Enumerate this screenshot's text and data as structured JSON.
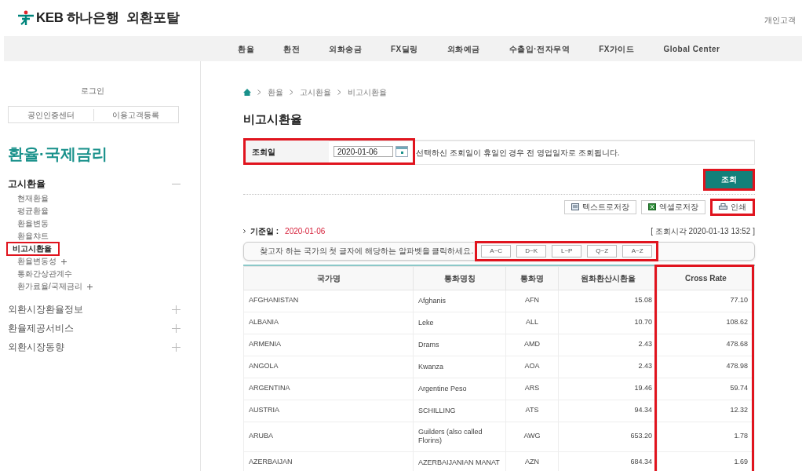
{
  "header": {
    "logo_text": "KEB 하나은행",
    "portal": "외환포탈",
    "customer_link": "개인고객"
  },
  "nav": [
    "환율",
    "환전",
    "외화송금",
    "FX딜링",
    "외화예금",
    "수출입·전자무역",
    "FX가이드",
    "Global Center"
  ],
  "sidebar": {
    "login": "로그인",
    "buttons": [
      "공인인증센터",
      "이용고객등록"
    ],
    "title": "환율·국제금리",
    "sections": [
      {
        "label": "고시환율",
        "expanded": true,
        "children": [
          {
            "label": "현재환율",
            "selected": false,
            "has_sub": false,
            "highlighted": false
          },
          {
            "label": "평균환율",
            "selected": false,
            "has_sub": false,
            "highlighted": false
          },
          {
            "label": "환율변동",
            "selected": false,
            "has_sub": false,
            "highlighted": false
          },
          {
            "label": "환율챠트",
            "selected": false,
            "has_sub": false,
            "highlighted": false
          },
          {
            "label": "비고시환율",
            "selected": true,
            "has_sub": false,
            "highlighted": true
          },
          {
            "label": "환율변동성",
            "selected": false,
            "has_sub": true,
            "highlighted": false
          },
          {
            "label": "통화간상관계수",
            "selected": false,
            "has_sub": false,
            "highlighted": false
          },
          {
            "label": "환가료율/국제금리",
            "selected": false,
            "has_sub": true,
            "highlighted": false
          }
        ]
      },
      {
        "label": "외환시장환율정보",
        "expanded": false
      },
      {
        "label": "환율제공서비스",
        "expanded": false
      },
      {
        "label": "외환시장동향",
        "expanded": false
      }
    ]
  },
  "breadcrumb": [
    "환율",
    "고시환율",
    "비고시환율"
  ],
  "page_title": "비고시환율",
  "query": {
    "label": "조회일",
    "date": "2020-01-06",
    "note": "선택하신 조회일이 휴일인 경우 전 영업일자로 조회됩니다.",
    "highlighted": true
  },
  "search_button": {
    "label": "조회",
    "highlighted": true
  },
  "export_buttons": [
    {
      "kind": "text",
      "label": "텍스트로저장",
      "highlighted": false
    },
    {
      "kind": "excel",
      "label": "엑셀로저장",
      "highlighted": false
    },
    {
      "kind": "print",
      "label": "인쇄",
      "highlighted": true
    }
  ],
  "base_date": {
    "label": "기준일 :",
    "value": "2020-01-06"
  },
  "query_time": "[ 조회시각 2020-01-13 13:52 ]",
  "alphabet": {
    "hint": "찾고자 하는 국가의 첫 글자에 해당하는 알파벳을 클릭하세요.",
    "buttons": [
      "A~C",
      "D~K",
      "L~P",
      "Q~Z",
      "A~Z"
    ],
    "highlighted": true
  },
  "table": {
    "columns": [
      {
        "label": "국가명",
        "highlighted": false
      },
      {
        "label": "통화명칭",
        "highlighted": false
      },
      {
        "label": "통화명",
        "highlighted": false
      },
      {
        "label": "원화환산시환율",
        "highlighted": false
      },
      {
        "label": "Cross Rate",
        "highlighted": true
      }
    ],
    "rows": [
      [
        "AFGHANISTAN",
        "Afghanis",
        "AFN",
        "15.08",
        "77.10"
      ],
      [
        "ALBANIA",
        "Leke",
        "ALL",
        "10.70",
        "108.62"
      ],
      [
        "ARMENIA",
        "Drams",
        "AMD",
        "2.43",
        "478.68"
      ],
      [
        "ANGOLA",
        "Kwanza",
        "AOA",
        "2.43",
        "478.98"
      ],
      [
        "ARGENTINA",
        "Argentine Peso",
        "ARS",
        "19.46",
        "59.74"
      ],
      [
        "AUSTRIA",
        "SCHILLING",
        "ATS",
        "94.34",
        "12.32"
      ],
      [
        "ARUBA",
        "Guilders (also called Florins)",
        "AWG",
        "653.20",
        "1.78"
      ],
      [
        "AZERBAIJAN",
        "AZERBAIJANIAN MANAT",
        "AZN",
        "684.34",
        "1.69"
      ]
    ]
  }
}
